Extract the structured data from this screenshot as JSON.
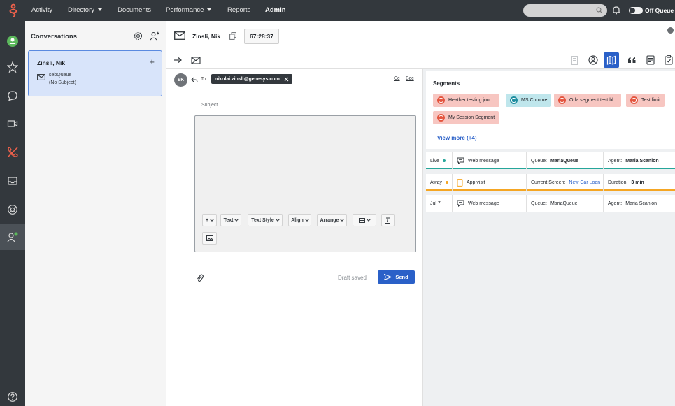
{
  "topnav": {
    "items": [
      {
        "label": "Activity",
        "caret": false
      },
      {
        "label": "Directory",
        "caret": true
      },
      {
        "label": "Documents",
        "caret": false
      },
      {
        "label": "Performance",
        "caret": true
      },
      {
        "label": "Reports",
        "caret": false
      },
      {
        "label": "Admin",
        "caret": false
      }
    ],
    "queue_toggle_label": "Off Queue"
  },
  "conversations": {
    "title": "Conversations",
    "card": {
      "name": "Zinsli, Nik",
      "queue": "sebQueue",
      "subject": "(No Subject)"
    }
  },
  "interaction": {
    "name": "Zinsli, Nik",
    "timer": "67:28:37"
  },
  "email": {
    "avatar_initials": "SK",
    "to_label": "To:",
    "to_recipient": "nikolai.zinsli@genesys.com",
    "cc_label": "Cc",
    "bcc_label": "Bcc",
    "subject_label": "Subject",
    "toolbar": {
      "text": "Text",
      "text_style": "Text Style",
      "align": "Align",
      "arrange": "Arrange"
    },
    "draft_status": "Draft saved",
    "send_label": "Send"
  },
  "segments": {
    "title": "Segments",
    "chips": [
      {
        "label": "Heather testing jour...",
        "color": "red"
      },
      {
        "label": "MS Chrome",
        "color": "teal"
      },
      {
        "label": "Orla segment test bl...",
        "color": "red"
      },
      {
        "label": "Test limit",
        "color": "red"
      },
      {
        "label": "My Session Segment",
        "color": "red"
      }
    ],
    "view_more": "View more (+4)"
  },
  "journey": {
    "rows": [
      {
        "status": "Live",
        "status_color": "#26a69a",
        "type": "Web message",
        "c3_label": "Queue:",
        "c3_value": "MariaQueue",
        "c4_label": "Agent:",
        "c4_value": "Maria Scanlon",
        "underline": "#26a69a"
      },
      {
        "status": "Away",
        "status_color": "#f5a623",
        "type": "App visit",
        "c3_label": "Current Screen:",
        "c3_value": "New Car Loan",
        "c4_label": "Duration:",
        "c4_value": "3 min",
        "underline": "#f5a623"
      },
      {
        "status": "Jul 7",
        "status_color": "",
        "type": "Web message",
        "c3_label": "Queue:",
        "c3_value": "MariaQueue",
        "c4_label": "Agent:",
        "c4_value": "Maria Scanlon",
        "underline": ""
      }
    ]
  },
  "colors": {
    "nav_bg": "#33383d",
    "accent": "#2a60c8",
    "brand": "#e4553f"
  }
}
